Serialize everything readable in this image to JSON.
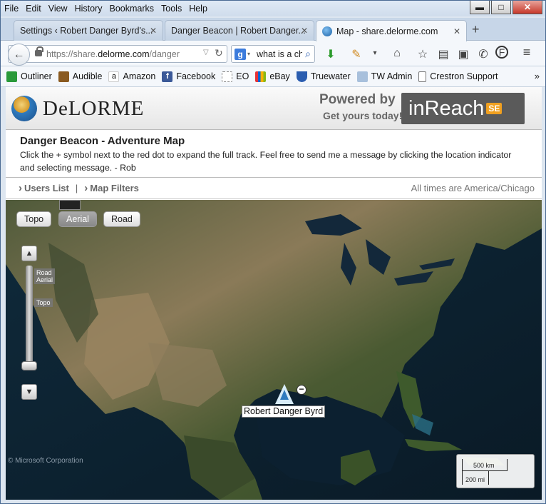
{
  "menu": [
    "File",
    "Edit",
    "View",
    "History",
    "Bookmarks",
    "Tools",
    "Help"
  ],
  "window_controls": {
    "minimize": "▬",
    "maximize": "□",
    "close": "✕"
  },
  "tabs": [
    {
      "label": "Settings ‹ Robert Danger Byrd's...",
      "close": "✕"
    },
    {
      "label": "Danger Beacon | Robert Danger...",
      "close": "✕"
    },
    {
      "label": "Map - share.delorme.com",
      "close": "✕"
    }
  ],
  "new_tab": "+",
  "nav": {
    "back": "←",
    "url_prefix": "https://share.",
    "url_domain": "delorme.com",
    "url_path": "/danger",
    "search_engine": "g",
    "search_value": "what is a ch",
    "icons": [
      "download-icon",
      "pencil-icon",
      "home-icon",
      "star-icon",
      "reader-icon",
      "pocket-icon",
      "social-icon",
      "evernote-icon",
      "menu-icon"
    ]
  },
  "bookmarks": [
    {
      "label": "Outliner",
      "color": "#2a9a3a"
    },
    {
      "label": "Audible",
      "color": "#8a5a20"
    },
    {
      "label": "Amazon",
      "color": "#f0a020"
    },
    {
      "label": "Facebook",
      "color": "#3b5998"
    },
    {
      "label": "EO",
      "color": "#ffffff"
    },
    {
      "label": "eBay",
      "color": "#e53238"
    },
    {
      "label": "Truewater",
      "color": "#2a5db0"
    },
    {
      "label": "TW Admin",
      "color": "#6a8fb8"
    },
    {
      "label": "Crestron Support",
      "color": "#ffffff"
    }
  ],
  "bookmarks_more": "»",
  "header": {
    "brand": "DeLORME",
    "powered": "Powered by",
    "getyours": "Get yours today!",
    "inreach": "inReach",
    "se": "SE"
  },
  "page": {
    "title": "Danger Beacon - Adventure Map",
    "description": "Click the + symbol next to the red dot to expand the full track. Feel free to send me a message by clicking the location indicator and selecting message. - Rob",
    "users_list": "Users List",
    "separator": "|",
    "map_filters": "Map Filters",
    "timezone": "All times are America/Chicago"
  },
  "map": {
    "types": [
      "Topo",
      "Aerial",
      "Road"
    ],
    "selected_type": "Aerial",
    "zoom_up": "▲",
    "zoom_down": "▼",
    "zoom_labels": [
      "Road\nAerial",
      "Topo"
    ],
    "marker_label": "Robert Danger Byrd",
    "collapse": "−",
    "copyright": "© Microsoft Corporation",
    "scale_km": "500 km",
    "scale_mi": "200 mi"
  }
}
